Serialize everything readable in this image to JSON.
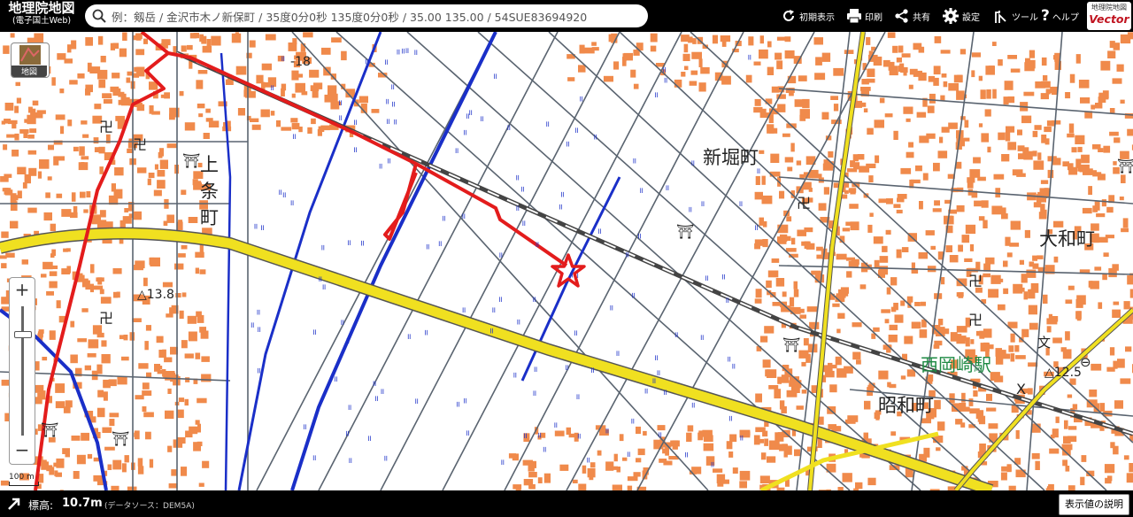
{
  "header": {
    "logo_title": "地理院地図",
    "logo_subtitle": "(電子国土Web)",
    "search_placeholder": "例：剱岳 / 金沢市木ノ新保町 / 35度0分0秒 135度0分0秒 / 35.00 135.00 / 54SUE83694920",
    "buttons": [
      {
        "label": "初期表示",
        "icon": "refresh-icon"
      },
      {
        "label": "印刷",
        "icon": "printer-icon"
      },
      {
        "label": "共有",
        "icon": "share-icon"
      },
      {
        "label": "設定",
        "icon": "gear-icon"
      },
      {
        "label": "ツール",
        "icon": "tool-icon"
      },
      {
        "label": "ヘルプ",
        "icon": "help-icon"
      }
    ],
    "brand_top": "地理院地図",
    "brand_bottom": "Vector"
  },
  "layer_button": {
    "label": "地図",
    "icon": "map-thumbnail-icon"
  },
  "zoom": {
    "plus": "+",
    "minus": "−",
    "level_fraction": 0.2
  },
  "scale": {
    "label": "100 m"
  },
  "map": {
    "labels": {
      "route": "18",
      "shinbori": "新堀町",
      "kamijo_1": "上",
      "kamijo_2": "条",
      "kamijo_3": "町",
      "yamato": "大和町",
      "showa": "昭和町",
      "station": "西岡崎駅",
      "elev1": "△13.8",
      "elev2": "△12.5"
    },
    "colors": {
      "track": "#e31c1c",
      "national_road": "#f0e020",
      "river": "#1a2fc8",
      "buildings": "#f08a4b",
      "station_text": "#1f8a44"
    },
    "marker_icon": "star-icon"
  },
  "footer": {
    "elevation_label": "標高:",
    "elevation_value": "10.7m",
    "data_source": "(データソース：DEM5A)",
    "explain_button": "表示値の説明"
  }
}
